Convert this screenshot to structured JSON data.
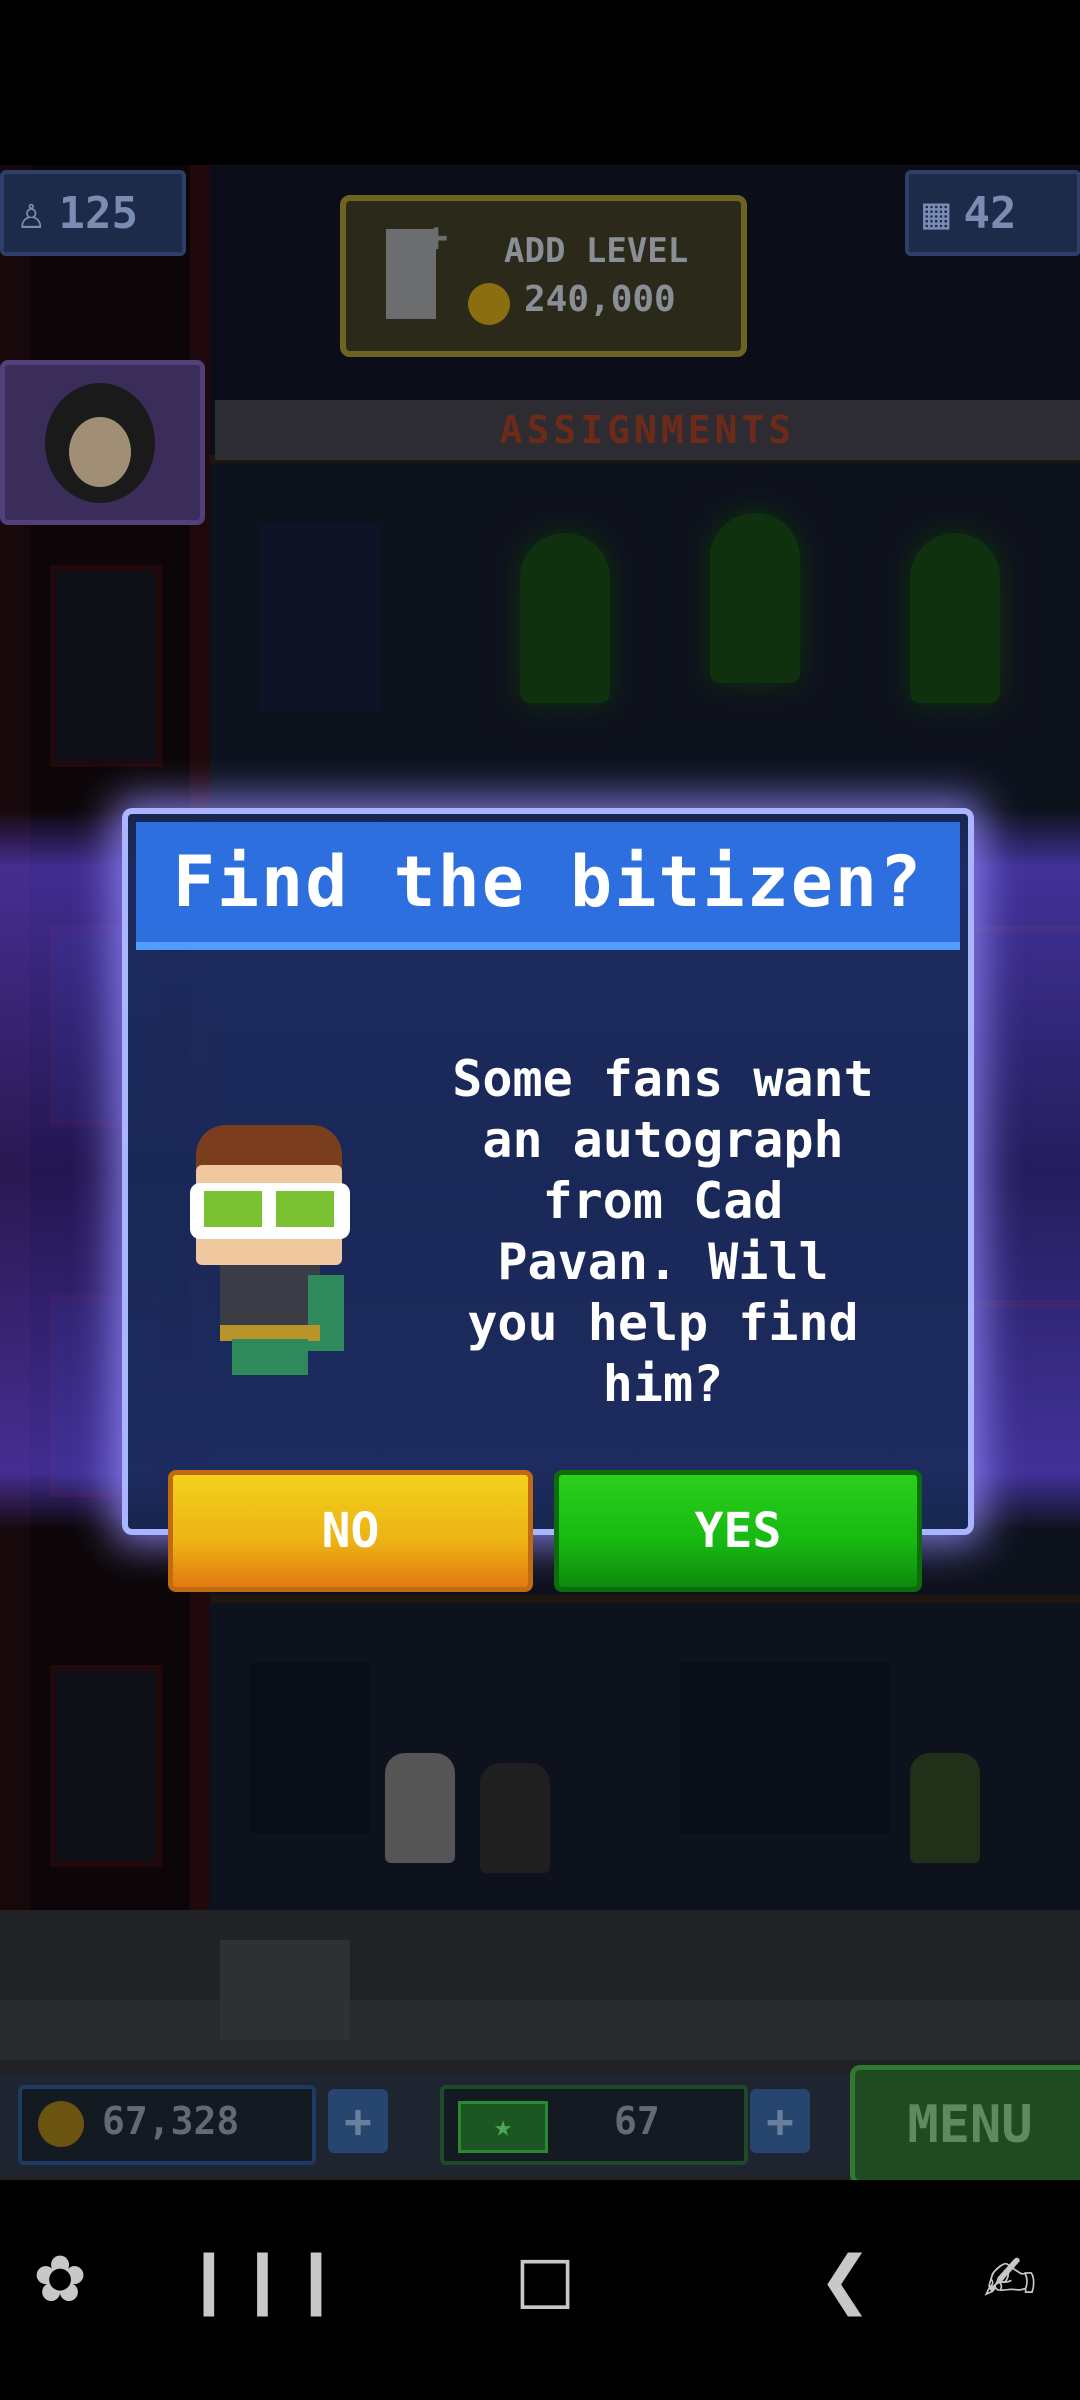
{
  "hud": {
    "population": "125",
    "floors": "42",
    "add_level_label": "ADD LEVEL",
    "add_level_cost": "240,000",
    "assignments_label": "ASSIGNMENTS"
  },
  "dialog": {
    "title": "Find the bitizen?",
    "message": "Some fans want an autograph from Cad Pavan. Will you help find him?",
    "no_label": "NO",
    "yes_label": "YES"
  },
  "bottom_hud": {
    "coins": "67,328",
    "bux": "67",
    "menu_label": "MENU"
  },
  "colors": {
    "dialog_header": "#2e6fe0",
    "yes_button": "#17b812",
    "no_button": "#ecb214",
    "glow": "#6c4cff"
  },
  "icons": [
    "person-icon",
    "building-icon",
    "add-level-icon",
    "coin-icon",
    "bux-icon",
    "game-launcher-icon",
    "recent-apps-icon",
    "home-icon",
    "back-icon",
    "accessibility-icon"
  ]
}
